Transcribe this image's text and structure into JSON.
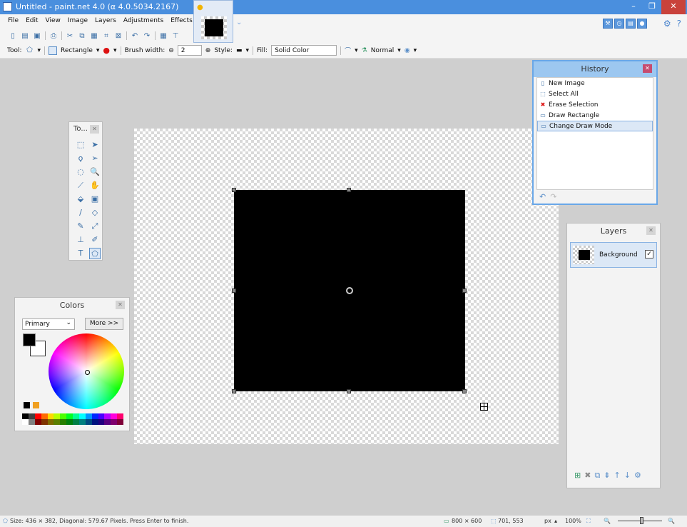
{
  "window": {
    "title": "Untitled - paint.net 4.0 (α 4.0.5034.2167)",
    "minimize": "–",
    "restore": "❐",
    "close": "✕"
  },
  "menu": [
    "File",
    "Edit",
    "View",
    "Image",
    "Layers",
    "Adjustments",
    "Effects"
  ],
  "toolbar": {
    "tool_label": "Tool:",
    "shape": "Rectangle",
    "brush_width_label": "Brush width:",
    "brush_width_value": "2",
    "style_label": "Style:",
    "fill_label": "Fill:",
    "fill_value": "Solid Color",
    "blend_mode": "Normal"
  },
  "tools_panel": {
    "title": "To..."
  },
  "colors_panel": {
    "title": "Colors",
    "mode": "Primary",
    "more_button": "More >>"
  },
  "history_panel": {
    "title": "History",
    "items": [
      {
        "icon": "new-image-icon",
        "label": "New Image"
      },
      {
        "icon": "select-all-icon",
        "label": "Select All"
      },
      {
        "icon": "erase-icon",
        "label": "Erase Selection"
      },
      {
        "icon": "rectangle-icon",
        "label": "Draw Rectangle"
      },
      {
        "icon": "rectangle-icon",
        "label": "Change Draw Mode"
      }
    ]
  },
  "layers_panel": {
    "title": "Layers",
    "layers": [
      {
        "name": "Background",
        "visible": true
      }
    ]
  },
  "status": {
    "message": "Size: 436 × 382, Diagonal: 579.67 Pixels. Press Enter to finish.",
    "image_size": "800 × 600",
    "cursor_pos": "701, 553",
    "units": "px",
    "zoom": "100%"
  },
  "colors": {
    "titlebar": "#4a8fde",
    "accent": "#69a7e8",
    "close": "#c9423b"
  }
}
